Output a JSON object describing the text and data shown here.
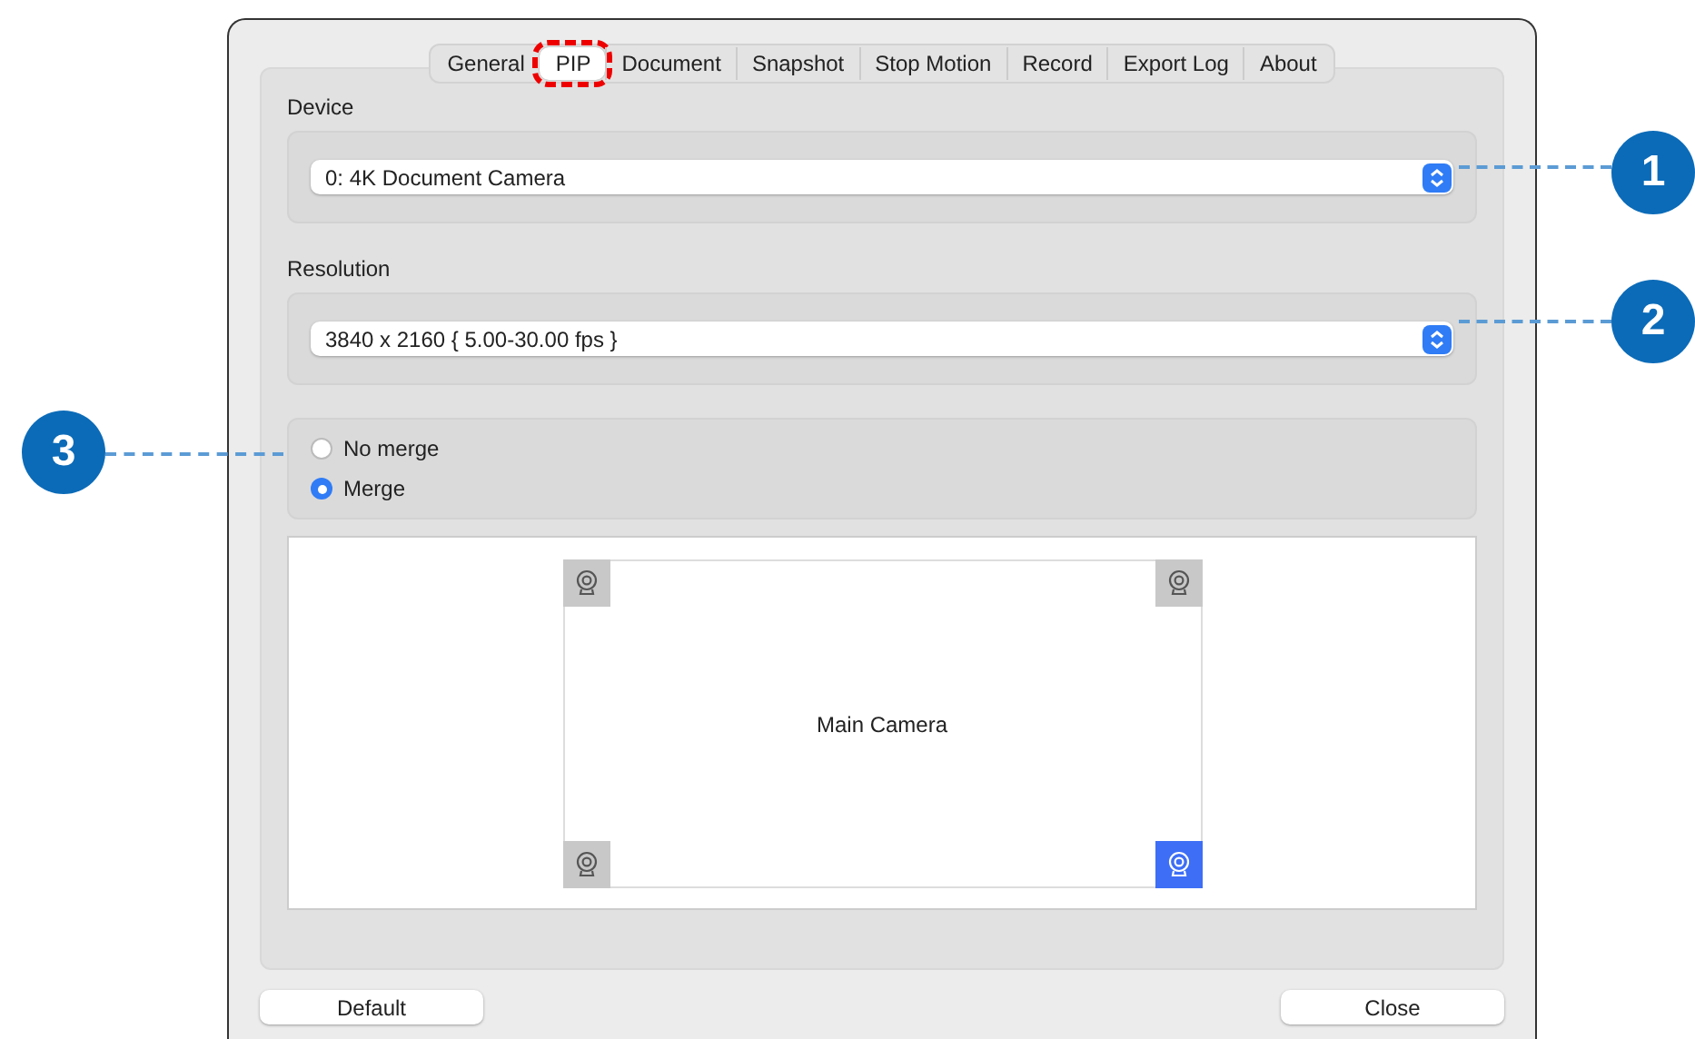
{
  "tabs": [
    {
      "label": "General",
      "selected": false,
      "highlighted": false
    },
    {
      "label": "PIP",
      "selected": true,
      "highlighted": true
    },
    {
      "label": "Document",
      "selected": false,
      "highlighted": false
    },
    {
      "label": "Snapshot",
      "selected": false,
      "highlighted": false
    },
    {
      "label": "Stop Motion",
      "selected": false,
      "highlighted": false
    },
    {
      "label": "Record",
      "selected": false,
      "highlighted": false
    },
    {
      "label": "Export Log",
      "selected": false,
      "highlighted": false
    },
    {
      "label": "About",
      "selected": false,
      "highlighted": false
    }
  ],
  "device": {
    "label": "Device",
    "value": "0: 4K Document Camera",
    "callout": "1"
  },
  "resolution": {
    "label": "Resolution",
    "value": "3840 x 2160 { 5.00-30.00 fps }",
    "callout": "2"
  },
  "merge": {
    "callout": "3",
    "options": [
      {
        "label": "No merge",
        "selected": false
      },
      {
        "label": "Merge",
        "selected": true
      }
    ]
  },
  "preview": {
    "main_label": "Main Camera",
    "positions": [
      {
        "selected": false
      },
      {
        "selected": false
      },
      {
        "selected": false
      },
      {
        "selected": true
      }
    ]
  },
  "buttons": [
    "Default",
    "Close"
  ]
}
